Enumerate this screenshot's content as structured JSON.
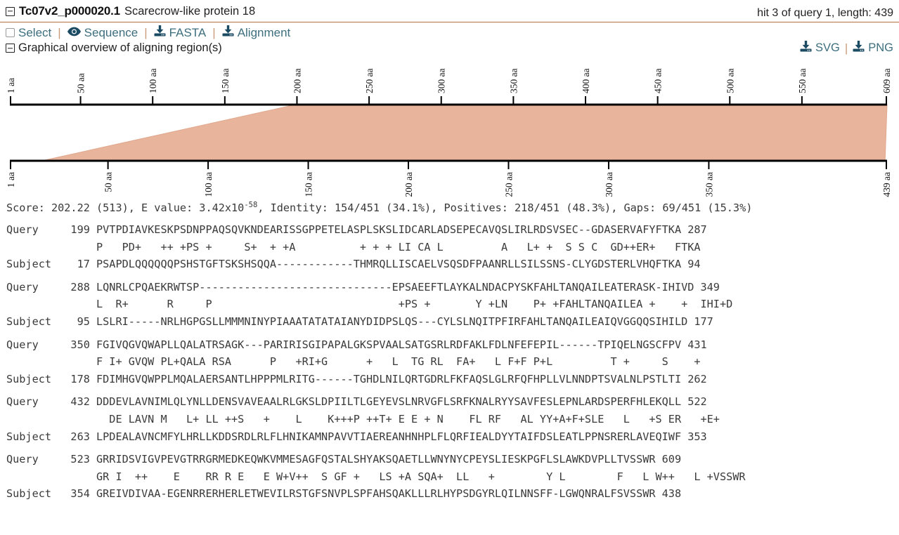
{
  "header": {
    "hit_id": "Tc07v2_p000020.1",
    "description": "Scarecrow-like protein 18",
    "meta": "hit 3 of query 1, length: 439",
    "collapse_icon": "minus-box-icon"
  },
  "actions": {
    "select_label": "Select",
    "sequence_label": "Sequence",
    "fasta_label": "FASTA",
    "alignment_label": "Alignment",
    "separator": "|",
    "checkbox_icon": "checkbox-icon",
    "eye_icon": "eye-icon",
    "download_icon": "download-icon"
  },
  "overview": {
    "title": "Graphical overview of aligning region(s)",
    "svg_label": "SVG",
    "png_label": "PNG",
    "separator": "|",
    "collapse_icon": "minus-box-icon"
  },
  "chart_data": {
    "type": "diagram",
    "title": "Graphical overview of aligning region(s)",
    "bar_color": "#e8b49b",
    "bar_stroke": "#e0a98e",
    "axis_color": "#000000",
    "query_axis": {
      "name": "query",
      "start": 1,
      "end": 609,
      "tick_labels": [
        "1 aa",
        "50 aa",
        "100 aa",
        "150 aa",
        "200 aa",
        "250 aa",
        "300 aa",
        "350 aa",
        "400 aa",
        "450 aa",
        "500 aa",
        "550 aa",
        "609 aa"
      ],
      "tick_values": [
        1,
        50,
        100,
        150,
        200,
        250,
        300,
        350,
        400,
        450,
        500,
        550,
        609
      ],
      "aligned_from": 199,
      "aligned_to": 609
    },
    "subject_axis": {
      "name": "subject",
      "start": 1,
      "end": 439,
      "tick_labels": [
        "1 aa",
        "50 aa",
        "100 aa",
        "150 aa",
        "200 aa",
        "250 aa",
        "300 aa",
        "350 aa",
        "439 aa"
      ],
      "tick_values": [
        1,
        50,
        100,
        150,
        200,
        250,
        300,
        350,
        439
      ],
      "aligned_from": 17,
      "aligned_to": 438
    }
  },
  "stats": {
    "prefix": "Score: 202.22 (513), E value: 3.42x10",
    "exponent": "-58",
    "suffix": ", Identity: 154/451 (34.1%), Positives: 218/451 (48.3%), Gaps: 69/451 (15.3%)"
  },
  "alignment": {
    "blocks": [
      {
        "query": "Query     199 PVTPDIAVKESKPSDNPPAQSQVKNDEARISSGPPETELASPLSKSLIDCARLADSEPECAVQSLIRLRDSVSEC--GDASERVAFYFTKA 287",
        "midline": "              P   PD+   ++ +PS +     S+  + +A          + + + LI CA L         A   L+ +  S S C  GD++ER+   FTKA",
        "subject": "Subject    17 PSAPDLQQQQQQPSHSTGFTSKSHSQQA------------THMRQLLISCAELVSQSDFPAANRLLSILSSNS-CLYGDSTERLVHQFTKA 94"
      },
      {
        "query": "Query     288 LQNRLCPQAEKRWTSP------------------------------EPSAEEFTLAYKALNDACPYSKFAHLTANQAILEATERASK-IHIVD 349",
        "midline": "              L  R+      R     P                             +PS +       Y +LN    P+ +FAHLTANQAILEA +    +  IHI+D",
        "subject": "Subject    95 LSLRI-----NRLHGPGSLLMMMNINYPIAAATATATAIANYDIDPSLQS---CYLSLNQITPFIRFAHLTANQAILEAIQVGGQQSIHILD 177"
      },
      {
        "query": "Query     350 FGIVQGVQWAPLLQALATRSAGK---PARIRISGIPAPALGKSPVAALSATGSRLRDFAKLFDLNFEFEPIL------TPIQELNGSCFPV 431",
        "midline": "              F I+ GVQW PL+QALA RSA      P   +RI+G      +   L  TG RL  FA+   L F+F P+L         T +     S    +",
        "subject": "Subject   178 FDIMHGVQWPPLMQALAERSANTLHPPPMLRITG------TGHDLNILQRTGDRLFKFAQSLGLRFQFHPLLVLNNDPTSVALNLPSTLTI 262"
      },
      {
        "query": "Query     432 DDDEVLAVNIMLQLYNLLDENSVAVEAALRLGKSLDPIILTLGEYEVSLNRVGFLSRFKNALRYYSAVFESLEPNLARDSPERFHLEKQLL 522",
        "midline": "                DE LAVN M   L+ LL ++S   +    L    K+++P ++T+ E E + N    FL RF   AL YY+A+F+SLE   L   +S ER   +E+",
        "subject": "Subject   263 LPDEALAVNCMFYLHRLLKDDSRDLRLFLHNIKAMNPAVVTIAEREANHNHPLFLQRFIEALDYYTAIFDSLEATLPPNSRERLAVEQIWF 353"
      },
      {
        "query": "Query     523 GRRIDSVIGVPEVGTRRGRMEDKEQWKVMMESAGFQSTALSHYAKSQAETLLWNYNYCPEYSLIESKPGFLSLAWKDVPLLTVSSWR 609",
        "midline": "              GR I  ++    E    RR R E   E W+V++  S GF +   LS +A SQA+  LL   +        Y L        F   L W++   L +VSSWR",
        "subject": "Subject   354 GREIVDIVAA-EGENRRERHERLETWEVILRSTGFSNVPLSPFAHSQAKLLLRLHYPSDGYRLQILNNSFF-LGWQNRALFSVSSWR 438"
      }
    ]
  }
}
